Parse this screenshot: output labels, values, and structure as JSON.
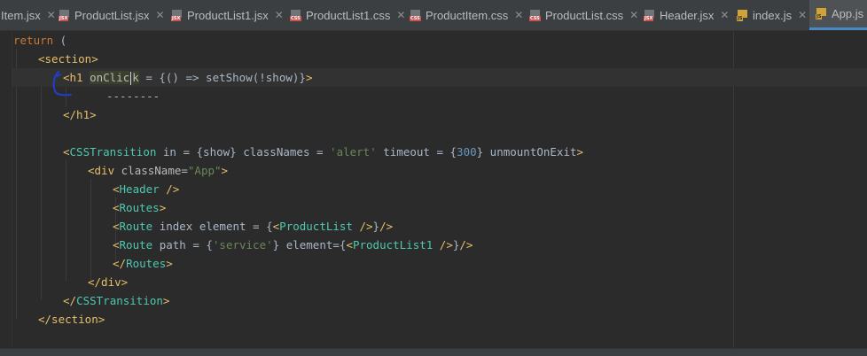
{
  "tabs": [
    {
      "label": "Item.jsx",
      "icon": "jsx-file-icon",
      "type": "jsx",
      "active": false
    },
    {
      "label": "ProductList.jsx",
      "icon": "jsx-file-icon",
      "type": "jsx",
      "active": false
    },
    {
      "label": "ProductList1.jsx",
      "icon": "jsx-file-icon",
      "type": "jsx",
      "active": false
    },
    {
      "label": "ProductList1.css",
      "icon": "css-file-icon",
      "type": "css",
      "active": false
    },
    {
      "label": "ProductItem.css",
      "icon": "css-file-icon",
      "type": "css",
      "active": false
    },
    {
      "label": "ProductList.css",
      "icon": "css-file-icon",
      "type": "css",
      "active": false
    },
    {
      "label": "Header.jsx",
      "icon": "jsx-file-icon",
      "type": "jsx",
      "active": false
    },
    {
      "label": "index.js",
      "icon": "js-file-icon",
      "type": "js",
      "active": false
    },
    {
      "label": "App.js",
      "icon": "js-file-icon",
      "type": "js",
      "active": true
    }
  ],
  "close_glyph": "✕",
  "icon_tags": {
    "jsx": "JSX",
    "css": "CSS",
    "js": "JS"
  },
  "code": {
    "l1": {
      "kw": "return",
      "rest": " ("
    },
    "l2": {
      "open": "<section>"
    },
    "l3": {
      "open": "<h1 ",
      "attr1": "onClic",
      "attr2": "k",
      "rest": " = {() => setShow(!show)}",
      "close": ">"
    },
    "l4": {
      "text": "--------"
    },
    "l5": {
      "close": "</h1>"
    },
    "l7": {
      "lt": "<",
      "comp": "CSSTransition",
      "a1": " in = {show} classNames = ",
      "s1": "'alert'",
      "a2": " timeout = {",
      "n1": "300",
      "a3": "} unmountOnExit",
      "gt": ">"
    },
    "l8": {
      "open": "<div ",
      "attr": "className=",
      "str": "\"App\"",
      "close": ">"
    },
    "l9": {
      "lt": "<",
      "comp": "Header",
      "gt": " />"
    },
    "l10": {
      "lt": "<",
      "comp": "Routes",
      "gt": ">"
    },
    "l11": {
      "lt": "<",
      "comp": "Route",
      "a1": " index element = {",
      "lt2": "<",
      "comp2": "ProductList",
      "gt2": " />",
      "a2": "}",
      "gt": "/>"
    },
    "l12": {
      "lt": "<",
      "comp": "Route",
      "a1": " path = {",
      "s1": "'service'",
      "a2": "} element={",
      "lt2": "<",
      "comp2": "ProductList1",
      "gt2": " />",
      "a3": "}",
      "gt": "/>"
    },
    "l13": {
      "lt": "</",
      "comp": "Routes",
      "gt": ">"
    },
    "l14": {
      "close": "</div>"
    },
    "l15": {
      "lt": "</",
      "comp": "CSSTransition",
      "gt": ">"
    },
    "l16": {
      "close": "</section>"
    }
  }
}
